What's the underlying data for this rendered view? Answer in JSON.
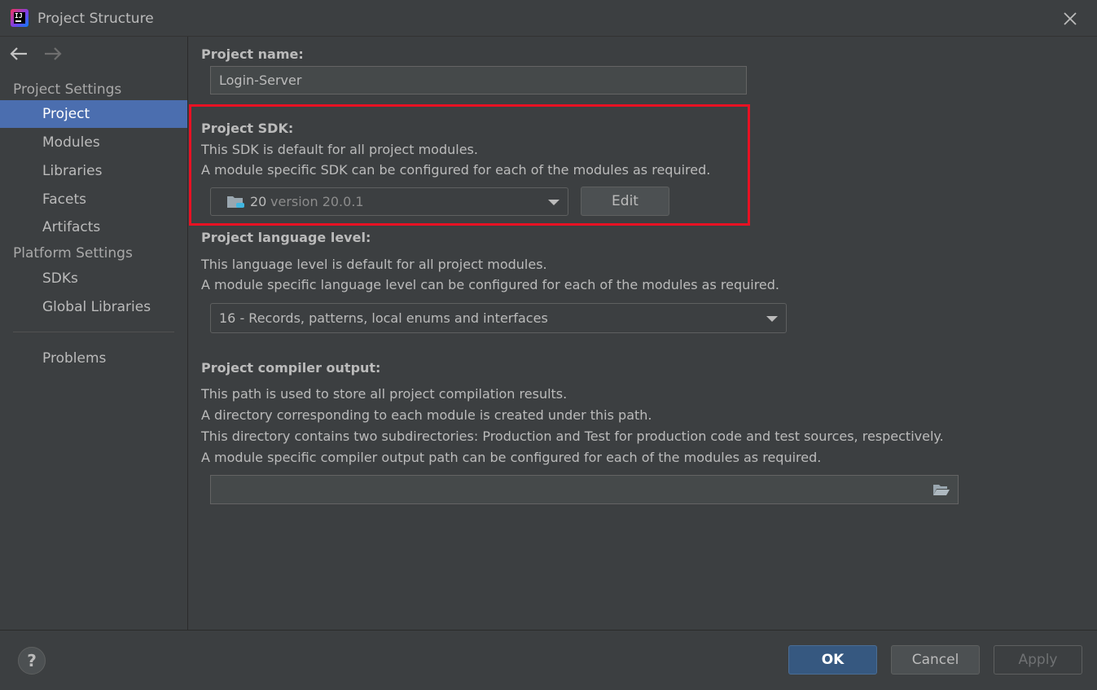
{
  "window": {
    "title": "Project Structure"
  },
  "sidebar": {
    "project_settings_label": "Project Settings",
    "project_items": [
      "Project",
      "Modules",
      "Libraries",
      "Facets",
      "Artifacts"
    ],
    "platform_settings_label": "Platform Settings",
    "platform_items": [
      "SDKs",
      "Global Libraries"
    ],
    "problems_label": "Problems",
    "selected": "Project"
  },
  "project_name": {
    "label": "Project name:",
    "value": "Login-Server"
  },
  "project_sdk": {
    "label": "Project SDK:",
    "desc_line1": "This SDK is default for all project modules.",
    "desc_line2": "A module specific SDK can be configured for each of the modules as required.",
    "sdk_name": "20",
    "sdk_version": "version 20.0.1",
    "edit_label": "Edit"
  },
  "language_level": {
    "label": "Project language level:",
    "desc_line1": "This language level is default for all project modules.",
    "desc_line2": "A module specific language level can be configured for each of the modules as required.",
    "value": "16 - Records, patterns, local enums and interfaces"
  },
  "compiler_output": {
    "label": "Project compiler output:",
    "desc_line1": "This path is used to store all project compilation results.",
    "desc_line2": "A directory corresponding to each module is created under this path.",
    "desc_line3": "This directory contains two subdirectories: Production and Test for production code and test sources, respectively.",
    "desc_line4": "A module specific compiler output path can be configured for each of the modules as required.",
    "value": ""
  },
  "footer": {
    "help": "?",
    "ok_label": "OK",
    "cancel_label": "Cancel",
    "apply_label": "Apply"
  },
  "colors": {
    "background": "#3c3f41",
    "selection": "#4b6eaf",
    "highlight_box": "#e81123",
    "ok_button": "#365880"
  }
}
